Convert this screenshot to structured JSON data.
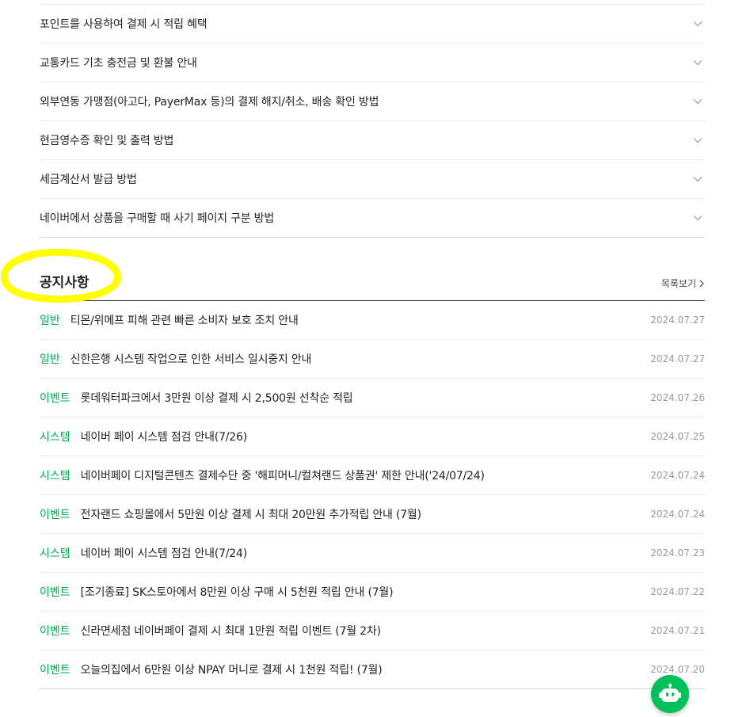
{
  "faq": {
    "items": [
      {
        "question": "포인트를 사용하여 결제 시 적립 혜택"
      },
      {
        "question": "교통카드 기초 충전금 및 환불 안내"
      },
      {
        "question": "외부연동 가맹점(아고다, PayerMax 등)의 결제 해지/취소, 배송 확인 방법"
      },
      {
        "question": "현금영수증 확인 및 출력 방법"
      },
      {
        "question": "세금계산서 발급 방법"
      },
      {
        "question": "네이버에서 상품을 구매할 때 사기 페이지 구분 방법"
      }
    ]
  },
  "notices": {
    "title": "공지사항",
    "more_label": "목록보기",
    "accent_color": "#03a94d",
    "items": [
      {
        "category": "일반",
        "title": "티몬/위메프 피해 관련 빠른 소비자 보호 조치 안내",
        "date": "2024.07.27"
      },
      {
        "category": "일반",
        "title": "신한은행 시스템 작업으로 인한 서비스 일시중지 안내",
        "date": "2024.07.27"
      },
      {
        "category": "이벤트",
        "title": "롯데워터파크에서 3만원 이상 결제 시 2,500원 선착순 적립",
        "date": "2024.07.26"
      },
      {
        "category": "시스템",
        "title": "네이버 페이 시스템 점검 안내(7/26)",
        "date": "2024.07.25"
      },
      {
        "category": "시스템",
        "title": "네이버페이 디지털콘텐츠 결제수단 중 '해피머니/컬쳐랜드 상품권' 제한 안내('24/07/24)",
        "date": "2024.07.24"
      },
      {
        "category": "이벤트",
        "title": "전자랜드 쇼핑몰에서 5만원 이상 결제 시 최대 20만원 추가적립 안내 (7월)",
        "date": "2024.07.24"
      },
      {
        "category": "시스템",
        "title": "네이버 페이 시스템 점검 안내(7/24)",
        "date": "2024.07.23"
      },
      {
        "category": "이벤트",
        "title": "[조기종료] SK스토아에서 8만원 이상 구매 시 5천원 적립 안내 (7월)",
        "date": "2024.07.22"
      },
      {
        "category": "이벤트",
        "title": "신라면세점 네이버페이 결제 시 최대 1만원 적립 이벤트 (7월 2차)",
        "date": "2024.07.21"
      },
      {
        "category": "이벤트",
        "title": "오늘의집에서 6만원 이상 NPAY 머니로 결제 시 1천원 적립! (7월)",
        "date": "2024.07.20"
      }
    ]
  },
  "chatbot": {
    "icon": "chatbot-icon",
    "color": "#00c05a"
  },
  "highlight_color": "#ffff00"
}
